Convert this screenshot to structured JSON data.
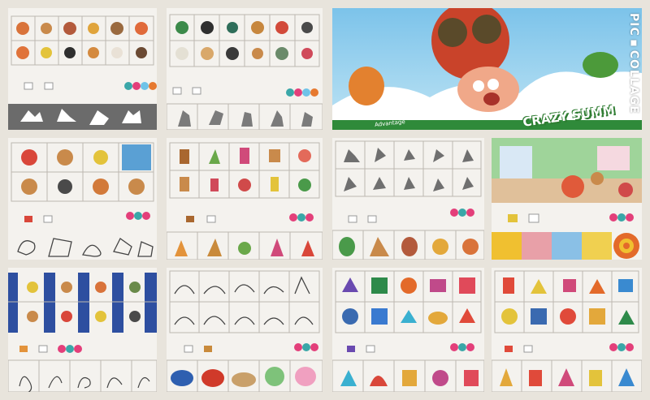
{
  "collage": {
    "watermark": "PIC▪COLLAGE",
    "cover_title": "CRAZY SUMM",
    "cover_subtitle": "Advantage"
  },
  "colors": {
    "paper": "#f4f2ee",
    "grid": "#b9b5ad",
    "teal": "#3aa7a8",
    "pink": "#e33f7a",
    "sky": "#6fc3e8",
    "orange": "#e6792f"
  }
}
